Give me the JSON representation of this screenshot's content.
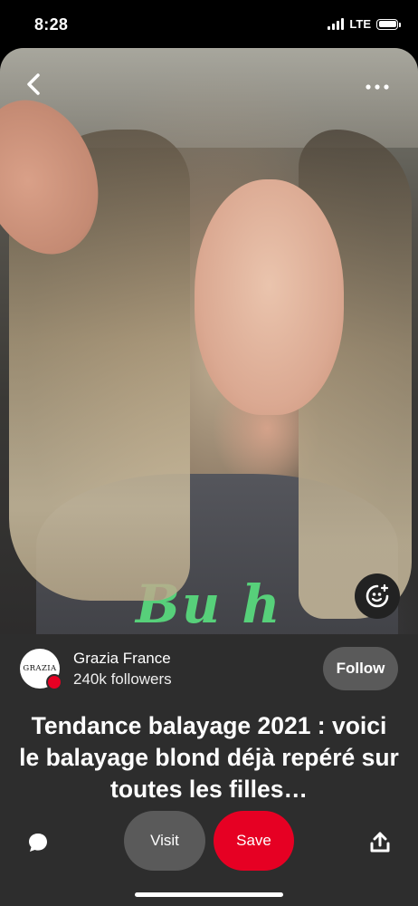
{
  "status_bar": {
    "time": "8:28",
    "network": "LTE",
    "signal_bars": 4,
    "battery_level": 1.0
  },
  "pin": {
    "creator_name": "Grazia France",
    "creator_followers": "240k followers",
    "avatar_text": "GRAZIA",
    "follow_label": "Follow",
    "title": "Tendance balayage 2021 : voici le balayage blond déjà repéré sur toutes les filles…",
    "shirt_print": "Bu..h"
  },
  "actions": {
    "visit_label": "Visit",
    "save_label": "Save"
  },
  "icons": {
    "back": "chevron-left-icon",
    "more": "ellipsis-icon",
    "lens": "visual-search-icon",
    "comment": "speech-bubble-icon",
    "share": "share-upload-icon",
    "verified": "verified-badge-icon"
  },
  "colors": {
    "save_red": "#e60023",
    "panel_bg": "#2d2d2d",
    "pill_gray": "#5a5a5a"
  }
}
